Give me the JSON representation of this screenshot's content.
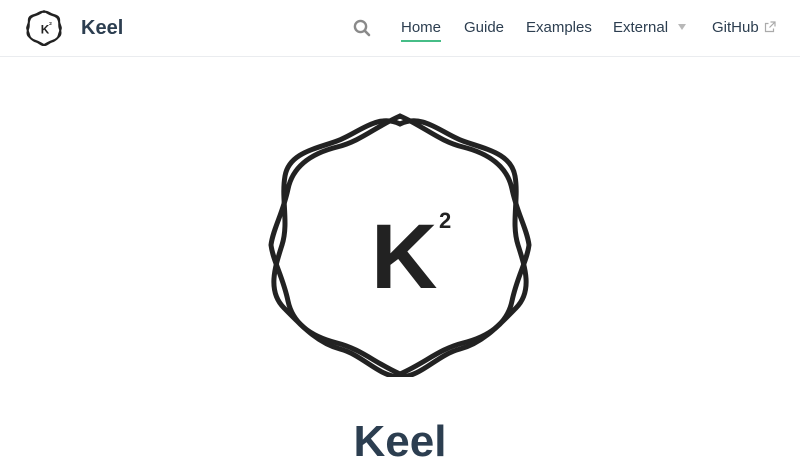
{
  "brand": {
    "title": "Keel",
    "logo_letter": "K",
    "logo_superscript": "2"
  },
  "search": {
    "icon": "search-icon"
  },
  "nav": {
    "home": "Home",
    "guide": "Guide",
    "examples": "Examples",
    "external": "External",
    "github": "GitHub"
  },
  "hero": {
    "logo_letter": "K",
    "logo_superscript": "2",
    "title": "Keel"
  },
  "colors": {
    "text": "#2c3e50",
    "accent": "#46bd87",
    "logo": "#222222",
    "border": "#eaecef"
  }
}
